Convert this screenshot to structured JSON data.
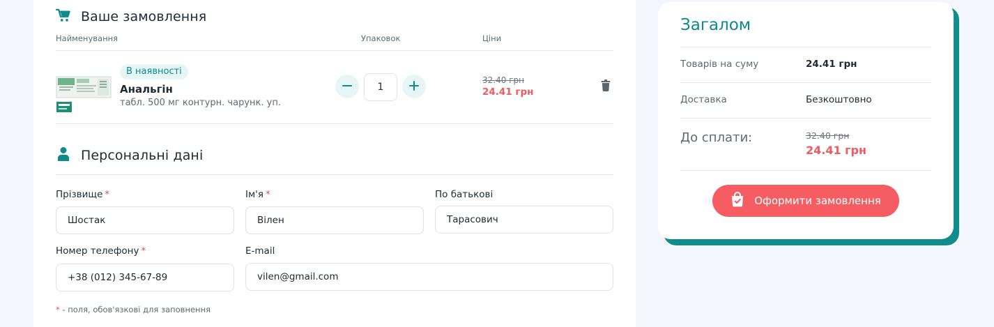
{
  "order": {
    "title": "Ваше замовлення",
    "col_name": "Найменування",
    "col_packs": "Упаковок",
    "col_price": "Ціни",
    "item": {
      "stock_badge": "В наявності",
      "name": "Анальгін",
      "description": "табл. 500 мг контурн. чарунк. уп.",
      "quantity": "1",
      "old_price": "32.40 грн",
      "new_price": "24.41 грн"
    }
  },
  "personal": {
    "title": "Персональні дані",
    "surname_label": "Прізвище",
    "surname_value": "Шостак",
    "firstname_label": "Ім'я",
    "firstname_value": "Вілен",
    "patronymic_label": "По батькові",
    "patronymic_value": "Тарасович",
    "phone_label": "Номер телефону",
    "phone_value": "+38 (012) 345-67-89",
    "email_label": "E-mail",
    "email_value": "vilen@gmail.com",
    "required_mark": "*",
    "required_note": " - поля, обов'язкові для заповнення"
  },
  "summary": {
    "title": "Загалом",
    "goods_label": "Товарів на суму",
    "goods_value": "24.41 грн",
    "delivery_label": "Доставка",
    "delivery_value": "Безкоштовно",
    "total_label": "До сплати:",
    "total_old": "32.40 грн",
    "total_new": "24.41 грн",
    "checkout_label": "Оформити замовлення"
  },
  "icons": {
    "cart": "cart-icon",
    "user": "user-icon",
    "minus": "minus-icon",
    "plus": "plus-icon",
    "trash": "trash-icon",
    "bag": "shopping-bag-check-icon"
  },
  "colors": {
    "accent": "#0d8a8c",
    "price_red": "#f25a5e",
    "button_red": "#f65d63",
    "background": "#f3f7fd"
  }
}
